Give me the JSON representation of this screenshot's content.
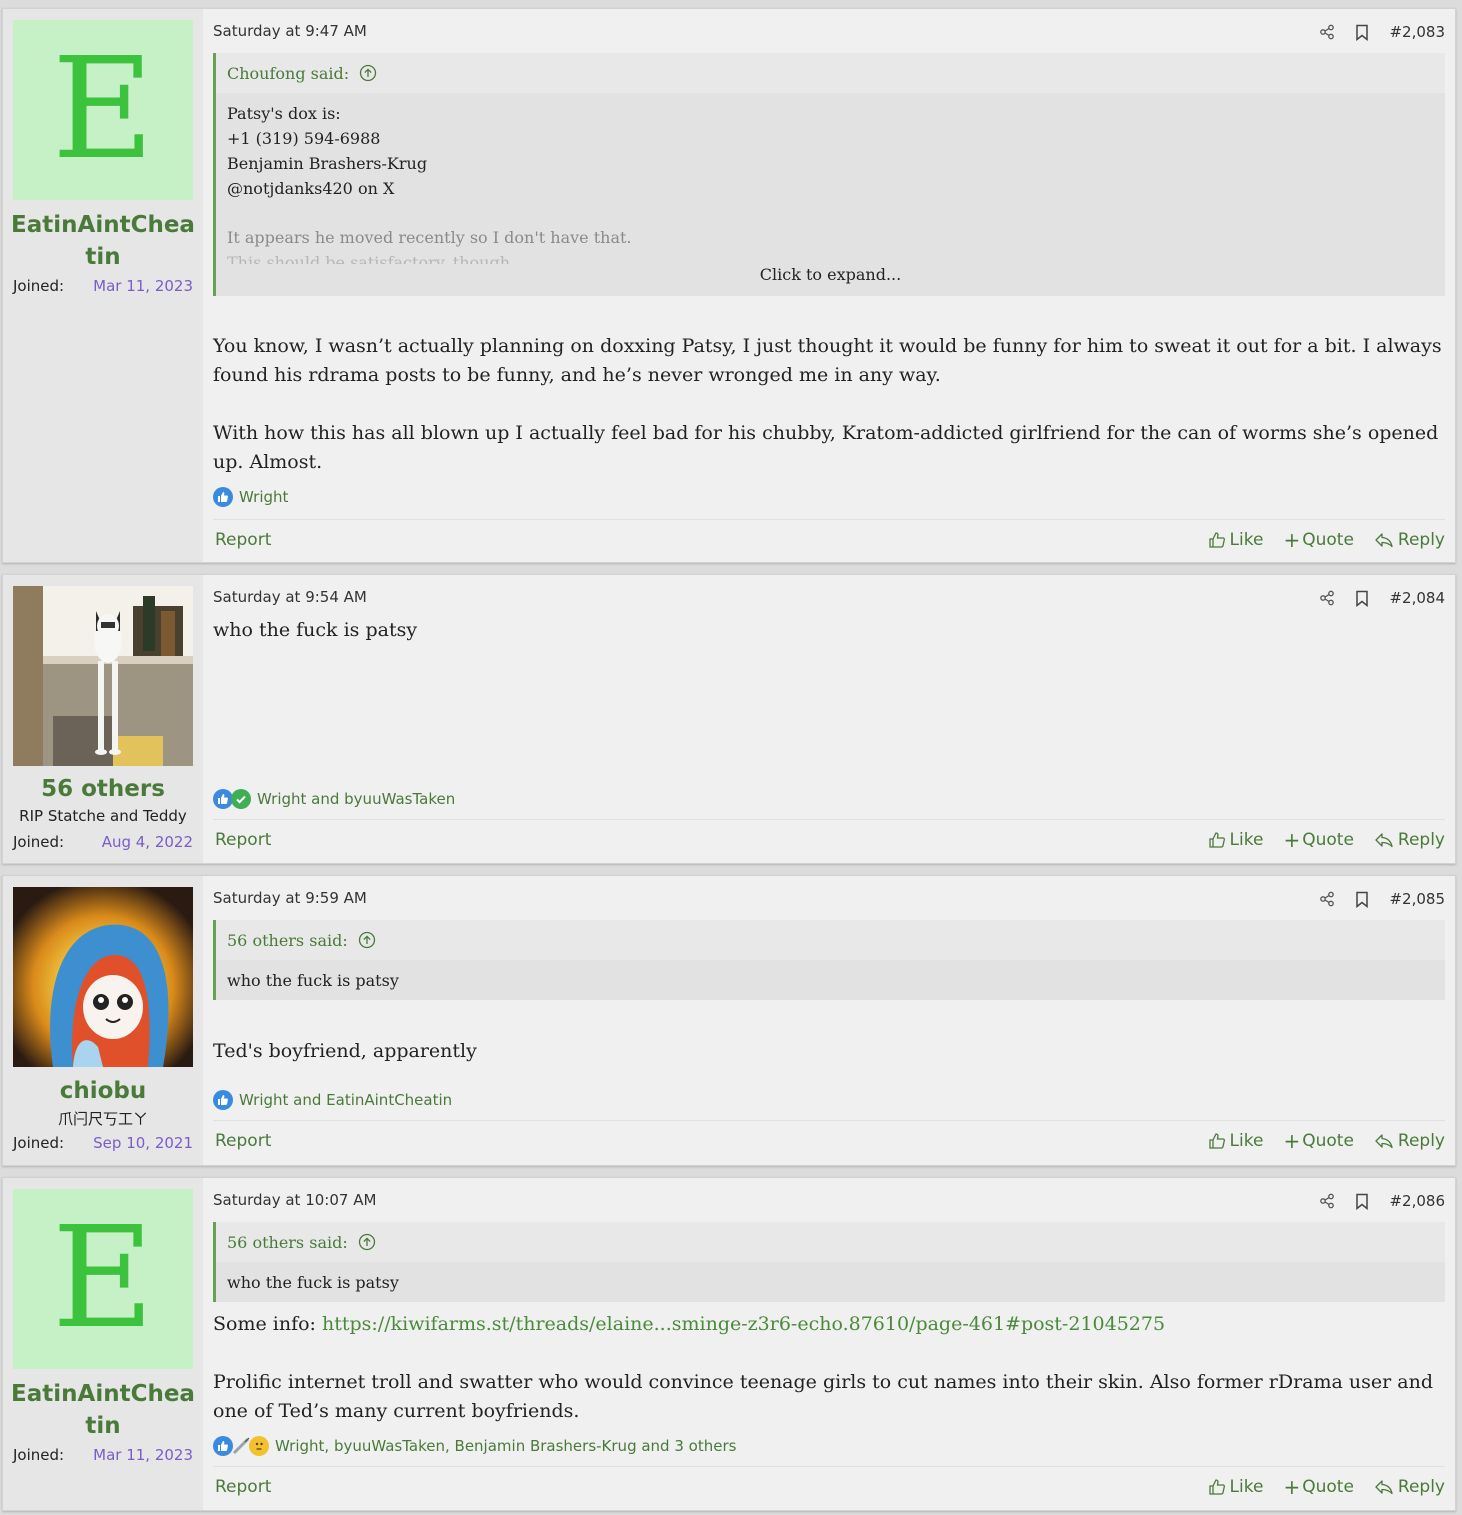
{
  "posts": [
    {
      "author": "EatinAintCheatin",
      "avatar_letter": "E",
      "joined_label": "Joined:",
      "joined_date": "Mar 11, 2023",
      "timestamp": "Saturday at 9:47 AM",
      "post_number": "#2,083",
      "quote": {
        "author_line": "Choufong said:",
        "lines": [
          "Patsy's dox is:",
          "+1 (319) 594-6988",
          "Benjamin Brashers-Krug",
          "@notjdanks420 on X"
        ],
        "faded_lines": [
          "It appears he moved recently so I don't have that.",
          "This should be satisfactory, though."
        ],
        "expand": "Click to expand..."
      },
      "paragraphs": [
        "You know, I wasn’t actually planning on doxxing Patsy, I just thought it would be funny for him to sweat it out for a bit. I always found his rdrama posts to be funny, and he’s never wronged me in any way.",
        "With how this has all blown up I actually feel bad for his chubby, Kratom-addicted girlfriend for the can of worms she’s opened up. Almost."
      ],
      "reactions": "Wright"
    },
    {
      "author": "56 others",
      "user_title": "RIP Statche and Teddy",
      "joined_label": "Joined:",
      "joined_date": "Aug 4, 2022",
      "timestamp": "Saturday at 9:54 AM",
      "post_number": "#2,084",
      "paragraphs": [
        "who the fuck is patsy"
      ],
      "reactions": "Wright and byuuWasTaken"
    },
    {
      "author": "chiobu",
      "user_title": "爪闩尺丂工ㄚ",
      "joined_label": "Joined:",
      "joined_date": "Sep 10, 2021",
      "timestamp": "Saturday at 9:59 AM",
      "post_number": "#2,085",
      "quote": {
        "author_line": "56 others said:",
        "lines": [
          "who the fuck is patsy"
        ]
      },
      "paragraphs": [
        "Ted's boyfriend, apparently"
      ],
      "reactions": "Wright and EatinAintCheatin"
    },
    {
      "author": "EatinAintCheatin",
      "avatar_letter": "E",
      "joined_label": "Joined:",
      "joined_date": "Mar 11, 2023",
      "timestamp": "Saturday at 10:07 AM",
      "post_number": "#2,086",
      "quote": {
        "author_line": "56 others said:",
        "lines": [
          "who the fuck is patsy"
        ]
      },
      "info_label": "Some info: ",
      "info_link": "https://kiwifarms.st/threads/elaine...sminge-z3r6-echo.87610/page-461#post-21045275",
      "paragraphs": [
        "Prolific internet troll and swatter who would convince teenage girls to cut names into their skin. Also former rDrama user and one of Ted’s many current boyfriends."
      ],
      "reactions": "Wright, byuuWasTaken, Benjamin Brashers-Krug and 3 others"
    }
  ],
  "actions": {
    "report": "Report",
    "like": "Like",
    "quote": "Quote",
    "reply": "Reply"
  },
  "colors": {
    "accent": "#4a7a3a",
    "joined_date": "#7b5cc9",
    "avatar_bg": "#c6f0c6",
    "avatar_letter": "#3cc23c"
  }
}
